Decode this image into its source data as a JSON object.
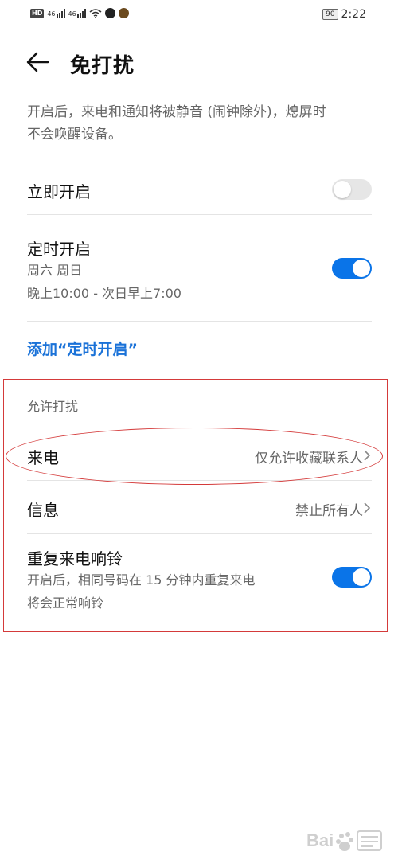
{
  "status_bar": {
    "hd_badge": "HD",
    "net1": "46",
    "net2": "46",
    "battery": "90",
    "time": "2:22"
  },
  "header": {
    "title": "免打扰",
    "back_icon": "back-arrow-icon"
  },
  "description": {
    "line1": "开启后，来电和通知将被静音 (闹钟除外)，熄屏时",
    "line2": "不会唤醒设备。"
  },
  "settings": {
    "immediate": {
      "label": "立即开启",
      "enabled": false
    },
    "scheduled": {
      "label": "定时开启",
      "days": "周六 周日",
      "time_range": "晚上10:00 - 次日早上7:00",
      "enabled": true
    },
    "add_schedule_label": "添加“定时开启”"
  },
  "allow_section": {
    "title": "允许打扰",
    "calls": {
      "label": "来电",
      "value": "仅允许收藏联系人"
    },
    "messages": {
      "label": "信息",
      "value": "禁止所有人"
    },
    "repeat_calls": {
      "label": "重复来电响铃",
      "desc_line1": "开启后，相同号码在 15 分钟内重复来电",
      "desc_line2": "将会正常响铃",
      "enabled": true
    }
  },
  "annotations": {
    "color": "#d43a3a"
  },
  "colors": {
    "accent": "#0a74e8",
    "link": "#1a72d8"
  },
  "watermark": {
    "logo": "baidu-jingyan-logo"
  }
}
